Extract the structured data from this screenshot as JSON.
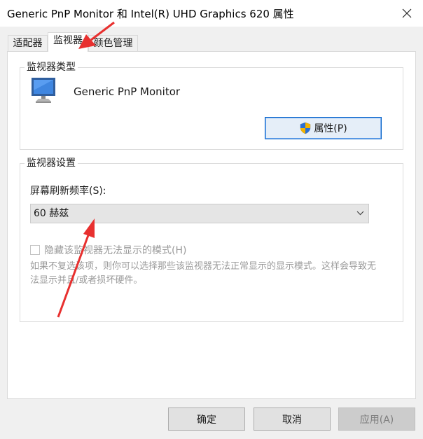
{
  "window": {
    "title": "Generic PnP Monitor 和 Intel(R) UHD Graphics 620 属性"
  },
  "tabs": [
    {
      "label": "适配器"
    },
    {
      "label": "监视器"
    },
    {
      "label": "颜色管理"
    }
  ],
  "monitor_type": {
    "group_title": "监视器类型",
    "monitor_name": "Generic PnP Monitor",
    "properties_button": "属性(P)"
  },
  "monitor_settings": {
    "group_title": "监视器设置",
    "refresh_label": "屏幕刷新频率(S):",
    "refresh_value": "60 赫兹",
    "hide_modes_label": "隐藏该监视器无法显示的模式(H)",
    "hide_modes_checked": false,
    "description": "如果不复选该项，则你可以选择那些该监视器无法正常显示的显示模式。这样会导致无法显示并且/或者损坏硬件。"
  },
  "buttons": {
    "ok": "确定",
    "cancel": "取消",
    "apply": "应用(A)"
  },
  "colors": {
    "annotation_arrow": "#e8302f",
    "accent_border": "#0a64c8"
  }
}
